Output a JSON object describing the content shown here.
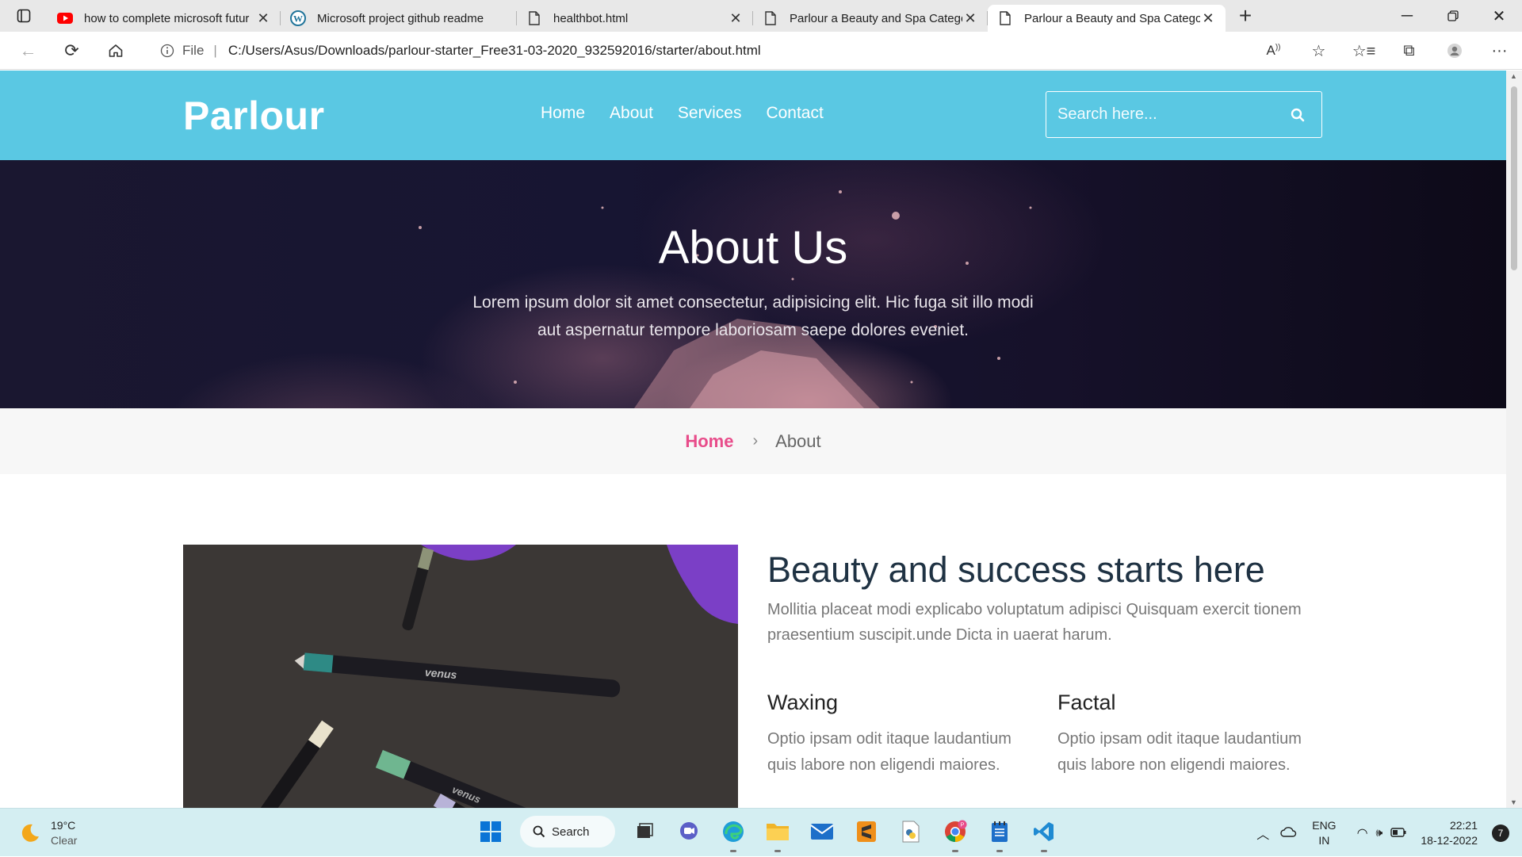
{
  "browser": {
    "tabs": [
      {
        "title": "how to complete microsoft futur",
        "icon": "youtube-icon"
      },
      {
        "title": "Microsoft project github readme",
        "icon": "wordpress-icon"
      },
      {
        "title": "healthbot.html",
        "icon": "file-icon"
      },
      {
        "title": "Parlour a Beauty and Spa Catego",
        "icon": "file-icon"
      },
      {
        "title": "Parlour a Beauty and Spa Catego",
        "icon": "file-icon",
        "active": true
      }
    ],
    "url_prefix": "File",
    "url": "C:/Users/Asus/Downloads/parlour-starter_Free31-03-2020_932592016/starter/about.html"
  },
  "site": {
    "logo": "Parlour",
    "nav": [
      "Home",
      "About",
      "Services",
      "Contact"
    ],
    "search_placeholder": "Search here...",
    "colors": {
      "header": "#5ac8e3",
      "accent": "#e84c8a",
      "heading": "#1f3243"
    }
  },
  "hero": {
    "title": "About Us",
    "text": "Lorem ipsum dolor sit amet consectetur, adipisicing elit. Hic fuga sit illo modi aut aspernatur tempore laboriosam saepe dolores eveniet."
  },
  "breadcrumb": {
    "home": "Home",
    "current": "About"
  },
  "about": {
    "heading": "Beauty and success starts here",
    "lead": "Mollitia placeat modi explicabo voluptatum adipisci Quisquam exercit tionem praesentium suscipit.unde Dicta in uaerat harum.",
    "photo_brand": "venus",
    "features": [
      {
        "title": "Waxing",
        "text": "Optio ipsam odit itaque laudantium quis labore non eligendi maiores."
      },
      {
        "title": "Factal",
        "text": "Optio ipsam odit itaque laudantium quis labore non eligendi maiores."
      }
    ]
  },
  "taskbar": {
    "temp": "19°C",
    "weather": "Clear",
    "search": "Search",
    "lang": "ENG",
    "region": "IN",
    "time": "22:21",
    "date": "18-12-2022",
    "notifications": "7"
  }
}
